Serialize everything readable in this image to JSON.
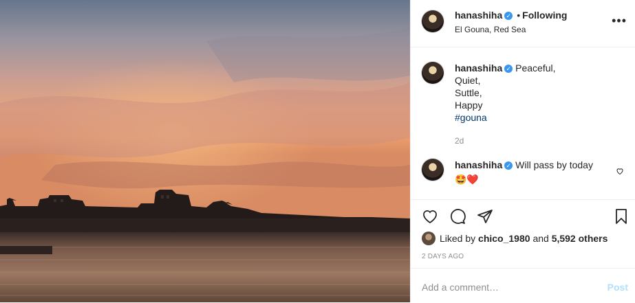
{
  "post": {
    "username": "hanashiha",
    "separator": "•",
    "follow_status": "Following",
    "location": "El Gouna, Red Sea",
    "more_icon": "more-horizontal-icon"
  },
  "caption": {
    "username": "hanashiha",
    "lines": [
      "Peaceful,",
      "Quiet,",
      "Suttle,",
      "Happy"
    ],
    "hashtag": "#gouna",
    "age": "2d"
  },
  "comment": {
    "username": "hanashiha",
    "text": "Will pass by today",
    "emojis": "🤩❤️"
  },
  "likes": {
    "prefix": "Liked by",
    "user": "chico_1980",
    "middle": "and",
    "others": "5,592 others"
  },
  "timestamp": "2 DAYS AGO",
  "add_comment": {
    "placeholder": "Add a comment…",
    "post_label": "Post"
  },
  "colors": {
    "verified": "#3897f0",
    "hashtag": "#00376b",
    "post_button": "#b2dffc"
  }
}
